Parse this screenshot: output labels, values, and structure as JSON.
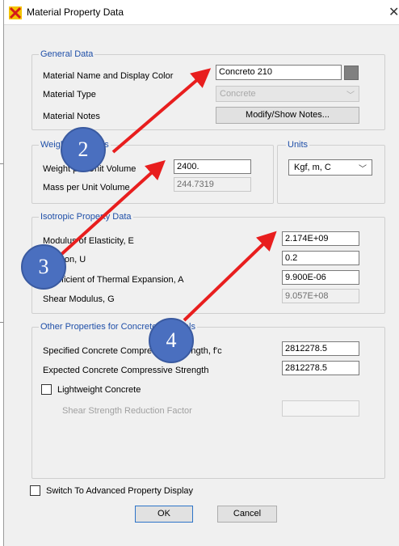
{
  "window": {
    "title": "Material Property Data",
    "close_glyph": "✕"
  },
  "general_data": {
    "title": "General Data",
    "name_label": "Material Name and Display Color",
    "name_value": "Concreto 210",
    "display_color": "#808080",
    "type_label": "Material Type",
    "type_value": "Concrete",
    "notes_label": "Material Notes",
    "notes_button": "Modify/Show Notes..."
  },
  "weight_mass": {
    "title": "Weight and Mass",
    "weight_label": "Weight per Unit Volume",
    "weight_value": "2400.",
    "mass_label": "Mass per Unit Volume",
    "mass_value": "244.7319"
  },
  "units": {
    "title": "Units",
    "value": "Kgf, m, C"
  },
  "isotropic": {
    "title": "Isotropic Property Data",
    "e_label": "Modulus of Elasticity,  E",
    "e_value": "2.174E+09",
    "u_label": "Poisson,  U",
    "u_value": "0.2",
    "a_label": "Coefficient of Thermal Expansion,  A",
    "a_value": "9.900E-06",
    "g_label": "Shear Modulus,  G",
    "g_value": "9.057E+08"
  },
  "other_props": {
    "title": "Other Properties for Concrete Materials",
    "fc_label": "Specified Concrete Compressive Strength,  f'c",
    "fc_value": "2812278.5",
    "expected_label": "Expected Concrete Compressive Strength",
    "expected_value": "2812278.5",
    "lightweight_label": "Lightweight Concrete",
    "lightweight_checked": false,
    "shear_reduction_label": "Shear Strength Reduction Factor",
    "shear_reduction_value": ""
  },
  "advanced_display_label": "Switch To Advanced Property Display",
  "advanced_display_checked": false,
  "buttons": {
    "ok": "OK",
    "cancel": "Cancel"
  },
  "annotations": {
    "color_arrow": "#e81e1e",
    "color_marker": "#4a6fbf",
    "markers": [
      {
        "label": "2",
        "target": "material-name-field"
      },
      {
        "label": "3",
        "target": "weight-per-volume-field"
      },
      {
        "label": "4",
        "target": "modulus-elasticity-field"
      }
    ]
  }
}
